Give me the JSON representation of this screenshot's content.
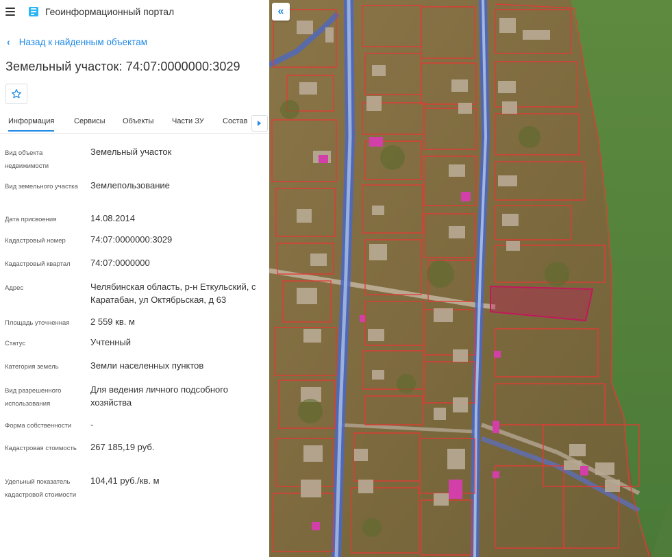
{
  "header": {
    "app_title": "Геоинформационный портал"
  },
  "nav": {
    "back_label": "Назад к найденным объектам"
  },
  "object": {
    "title": "Земельный участок: 74:07:0000000:3029"
  },
  "tabs": [
    "Информация",
    "Сервисы",
    "Объекты",
    "Части ЗУ",
    "Состав"
  ],
  "info": [
    {
      "label": "Вид объекта недвижимости",
      "value": "Земельный участок"
    },
    {
      "label": "Вид земельного участка",
      "value": "Землепользование"
    },
    {
      "label": "Дата присвоения",
      "value": "14.08.2014"
    },
    {
      "label": "Кадастровый номер",
      "value": "74:07:0000000:3029"
    },
    {
      "label": "Кадастровый квартал",
      "value": "74:07:0000000"
    },
    {
      "label": "Адрес",
      "value": "Челябинская область, р-н Еткульский, с Каратабан, ул Октябрьская, д 63"
    },
    {
      "label": "Площадь уточненная",
      "value": "2 559 кв. м"
    },
    {
      "label": "Статус",
      "value": "Учтенный"
    },
    {
      "label": "Категория земель",
      "value": "Земли населенных пунктов"
    },
    {
      "label": "Вид разрешенного использования",
      "value": "Для ведения личного подсобного хозяйства"
    },
    {
      "label": "Форма собственности",
      "value": "-"
    },
    {
      "label": "Кадастровая стоимость",
      "value": "267 185,19 руб."
    },
    {
      "label": "Удельный показатель кадастровой стоимости",
      "value": "104,41 руб./кв. м"
    }
  ],
  "map": {
    "collapse_label": "«"
  },
  "colors": {
    "accent": "#1e88e5",
    "parcel_outline": "#e53935",
    "selected_parcel": "#c2185b",
    "road_blue": "#3f51b5"
  },
  "icons": {
    "menu": "menu-icon",
    "logo": "logo-icon",
    "favorite": "star-icon",
    "back": "chevron-left-icon",
    "tab_scroll": "chevron-right-icon"
  }
}
